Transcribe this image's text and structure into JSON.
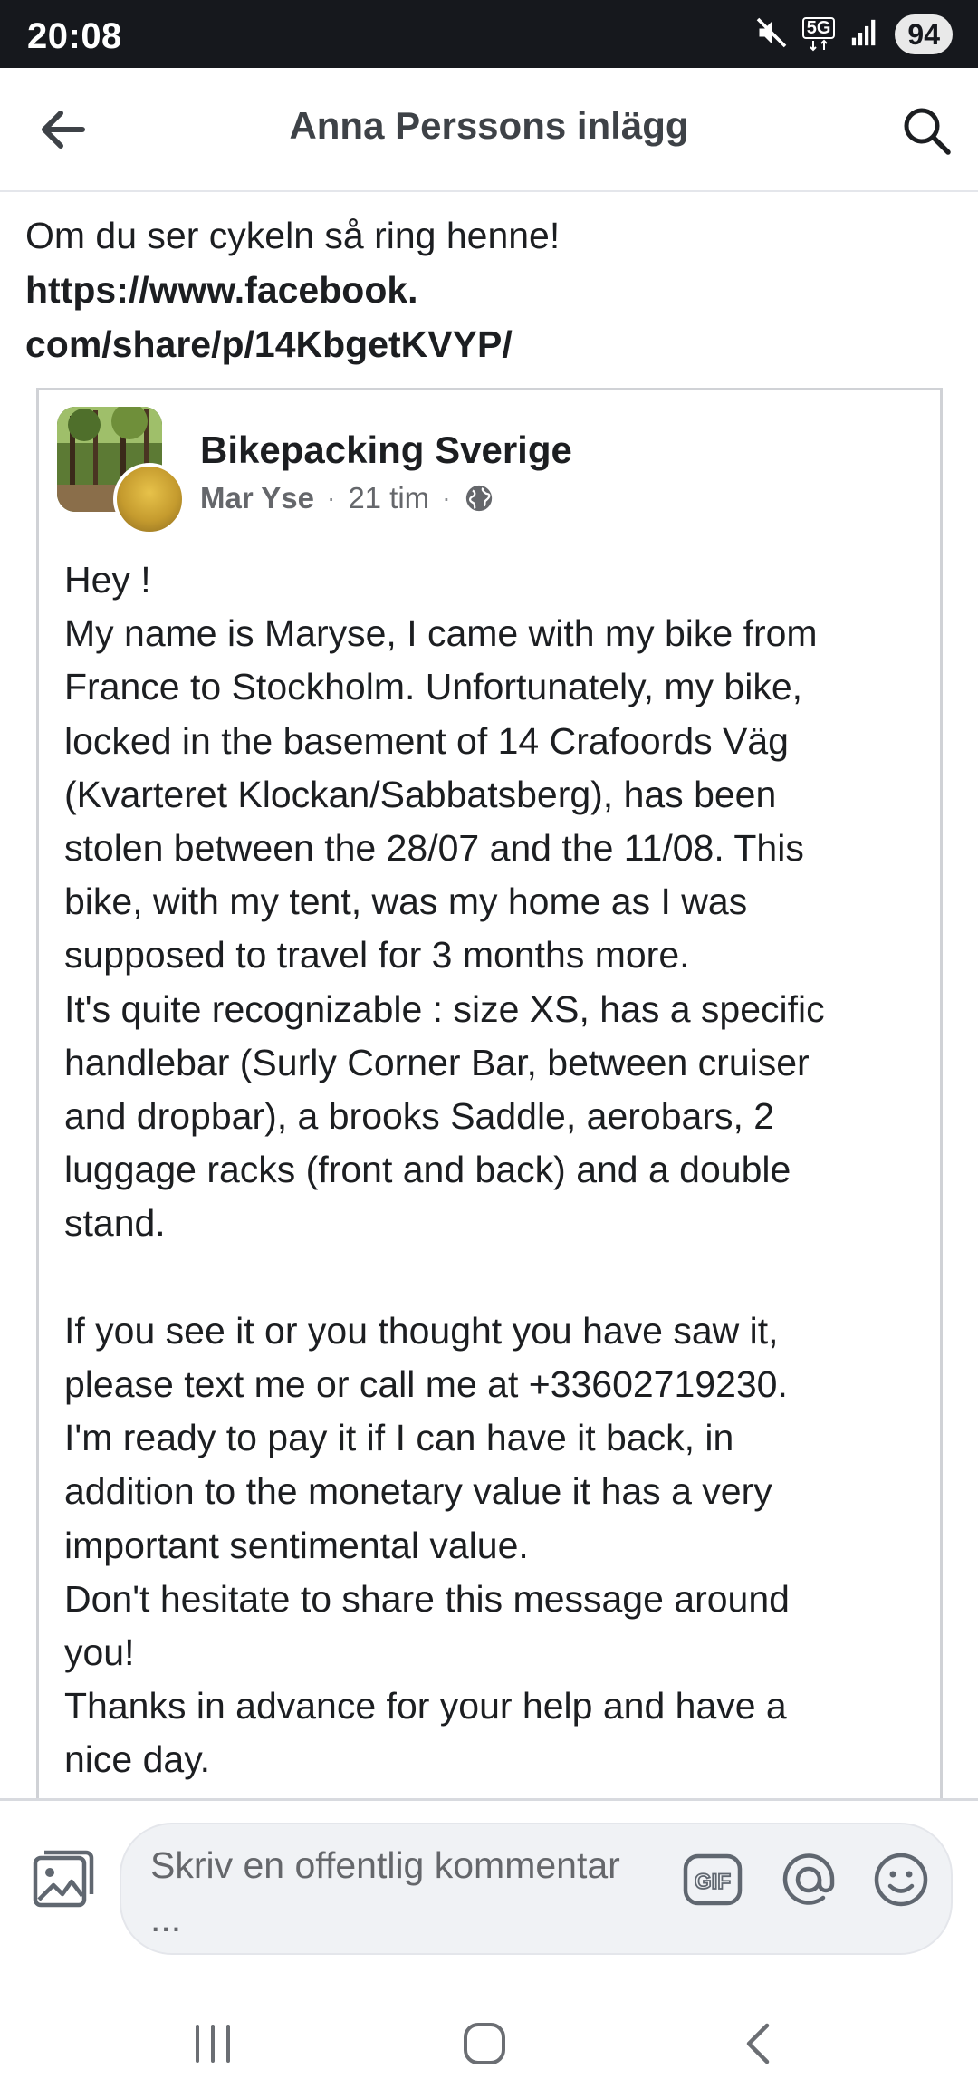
{
  "status_bar": {
    "time": "20:08",
    "network": "5G",
    "battery": "94"
  },
  "header": {
    "title": "Anna Perssons inlägg"
  },
  "post": {
    "intro_text": "Om du ser cykeln så ring henne!",
    "link_line1": "https://www.facebook.",
    "link_line2": "com/share/p/14KbgetKVYP/"
  },
  "shared_post": {
    "group_name": "Bikepacking Sverige",
    "author": "Mar Yse",
    "time": "21 tim",
    "separator": "·",
    "body": "Hey !\nMy name is Maryse, I came with my bike from\nFrance to Stockholm. Unfortunately, my bike,\nlocked in the basement of 14 Crafoords Väg\n(Kvarteret Klockan/Sabbatsberg), has been\nstolen between the 28/07 and the 11/08. This\nbike, with my tent, was my home as I was\nsupposed to travel for 3 months more.\nIt's quite recognizable : size XS, has a specific\nhandlebar (Surly Corner Bar, between cruiser\nand dropbar), a brooks Saddle, aerobars, 2\nluggage racks (front and back) and a double\nstand.\n\nIf you see it or you thought you have saw it,\nplease text me or call me at +33602719230.\nI'm ready to pay it if I can have it back, in\naddition to the monetary value it has a very\nimportant sentimental value.\nDon't hesitate to share this message around\nyou!\nThanks in advance for your help and have a\nnice day."
  },
  "comment_bar": {
    "placeholder": "Skriv en offentlig kommentar ...",
    "gif_label": "GIF"
  },
  "icons": {
    "back": "arrow-left-icon",
    "search": "search-icon",
    "photo": "photo-icon",
    "gif": "gif-icon",
    "mention": "at-icon",
    "emoji": "emoji-icon",
    "globe": "globe-icon"
  }
}
